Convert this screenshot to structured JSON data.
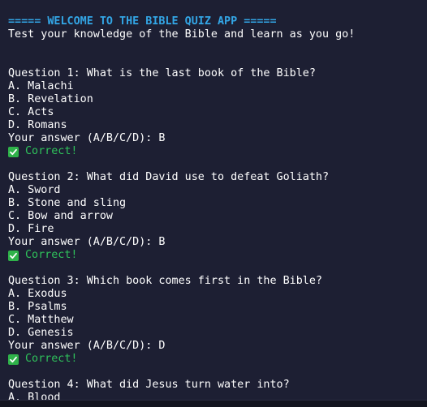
{
  "terminal": {
    "banner": "===== WELCOME TO THE BIBLE QUIZ APP =====",
    "intro": "Test your knowledge of the Bible and learn as you go!",
    "questions": [
      {
        "prompt": "Question 1: What is the last book of the Bible?",
        "options": [
          "A. Malachi",
          "B. Revelation",
          "C. Acts",
          "D. Romans"
        ],
        "answer_line": "Your answer (A/B/C/D): B",
        "result": "Correct!"
      },
      {
        "prompt": "Question 2: What did David use to defeat Goliath?",
        "options": [
          "A. Sword",
          "B. Stone and sling",
          "C. Bow and arrow",
          "D. Fire"
        ],
        "answer_line": "Your answer (A/B/C/D): B",
        "result": "Correct!"
      },
      {
        "prompt": "Question 3: Which book comes first in the Bible?",
        "options": [
          "A. Exodus",
          "B. Psalms",
          "C. Matthew",
          "D. Genesis"
        ],
        "answer_line": "Your answer (A/B/C/D): D",
        "result": "Correct!"
      },
      {
        "prompt": "Question 4: What did Jesus turn water into?",
        "options": [
          "A. Blood"
        ]
      }
    ],
    "colors": {
      "background": "#1d1f33",
      "banner": "#33a6e6",
      "text": "#ffffff",
      "correct": "#2fc25b"
    },
    "result_icon": "check-mark-icon"
  }
}
